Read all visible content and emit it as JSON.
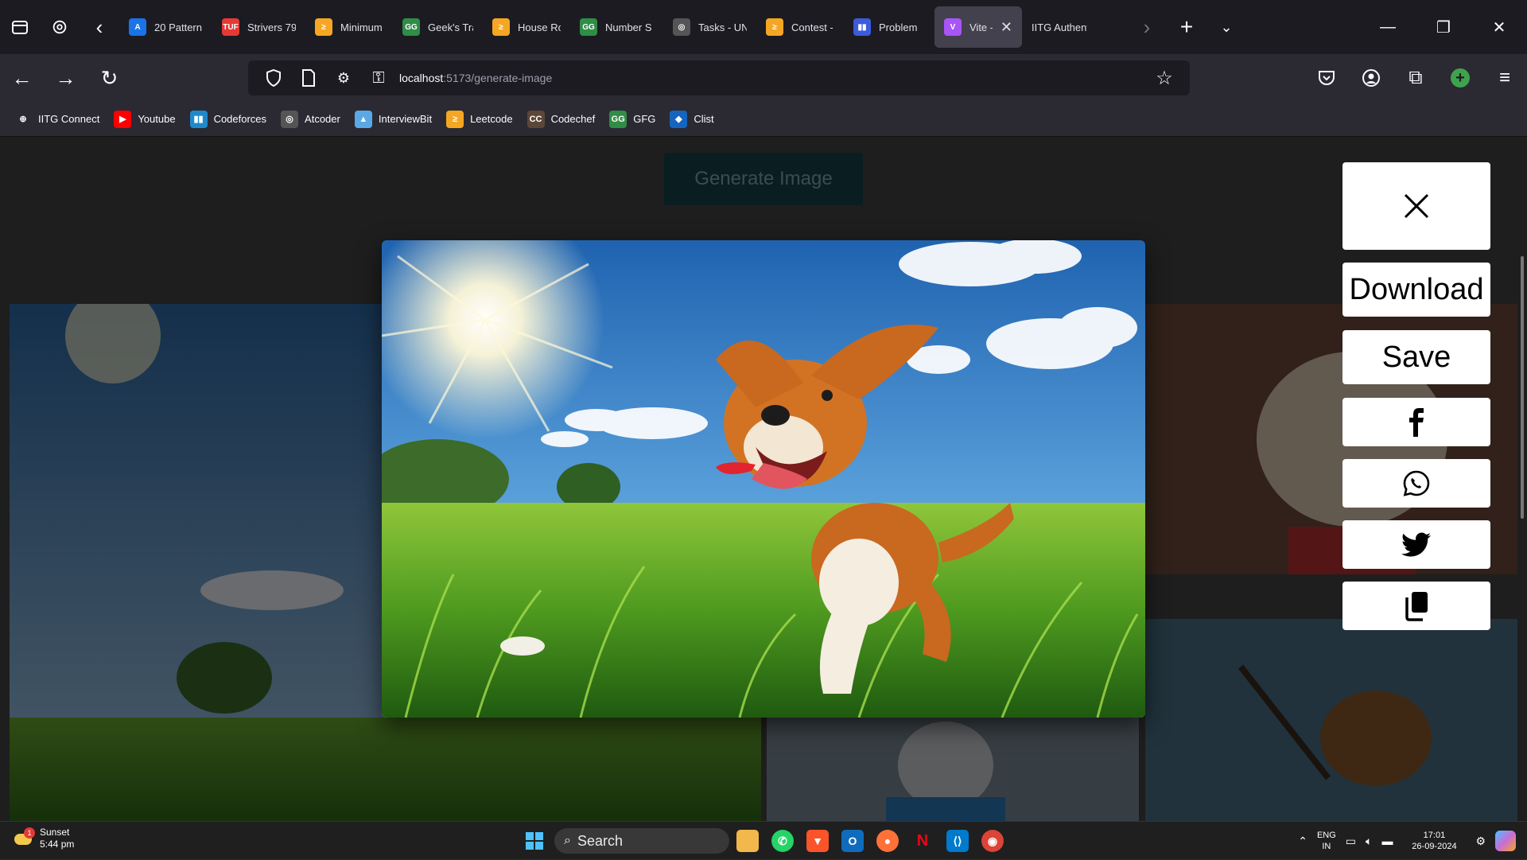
{
  "tabs": [
    {
      "label": "20 Pattern",
      "fav": "A",
      "fav_color": "#1a73e8",
      "active": false
    },
    {
      "label": "Strivers 79",
      "fav": "TUF",
      "fav_color": "#e53935",
      "active": false
    },
    {
      "label": "Minimum",
      "fav": "≥",
      "fav_color": "#f5a623",
      "active": false
    },
    {
      "label": "Geek's Tra",
      "fav": "GG",
      "fav_color": "#2f8d46",
      "active": false
    },
    {
      "label": "House Ro",
      "fav": "≥",
      "fav_color": "#f5a623",
      "active": false
    },
    {
      "label": "Number S",
      "fav": "GG",
      "fav_color": "#2f8d46",
      "active": false
    },
    {
      "label": "Tasks - UN",
      "fav": "◎",
      "fav_color": "#555555",
      "active": false
    },
    {
      "label": "Contest -",
      "fav": "≥",
      "fav_color": "#f5a623",
      "active": false
    },
    {
      "label": "Problem",
      "fav": "▮▮",
      "fav_color": "#3b5bdb",
      "active": false
    },
    {
      "label": "Vite -",
      "fav": "V",
      "fav_color": "#a855f7",
      "active": true
    },
    {
      "label": "IITG Authenticat",
      "fav": "",
      "fav_color": "",
      "active": false
    }
  ],
  "url": {
    "host": "localhost",
    "path": ":5173/generate-image"
  },
  "bookmarks": [
    {
      "label": "IITG Connect",
      "fav": "⊕",
      "fav_color": "#2b2a33"
    },
    {
      "label": "Youtube",
      "fav": "▶",
      "fav_color": "#ff0000"
    },
    {
      "label": "Codeforces",
      "fav": "▮▮",
      "fav_color": "#1f8acb"
    },
    {
      "label": "Atcoder",
      "fav": "◎",
      "fav_color": "#555555"
    },
    {
      "label": "InterviewBit",
      "fav": "▲",
      "fav_color": "#5aa9e6"
    },
    {
      "label": "Leetcode",
      "fav": "≥",
      "fav_color": "#f5a623"
    },
    {
      "label": "Codechef",
      "fav": "CC",
      "fav_color": "#5b4638"
    },
    {
      "label": "GFG",
      "fav": "GG",
      "fav_color": "#2f8d46"
    },
    {
      "label": "Clist",
      "fav": "◆",
      "fav_color": "#1565c0"
    }
  ],
  "page": {
    "generate_button": "Generate Image"
  },
  "actions": {
    "download": "Download",
    "save": "Save"
  },
  "taskbar": {
    "weather_title": "Sunset",
    "weather_time": "5:44 pm",
    "weather_badge": "1",
    "search_placeholder": "Search",
    "lang_1": "ENG",
    "lang_2": "IN",
    "time": "17:01",
    "date": "26-09-2024"
  }
}
